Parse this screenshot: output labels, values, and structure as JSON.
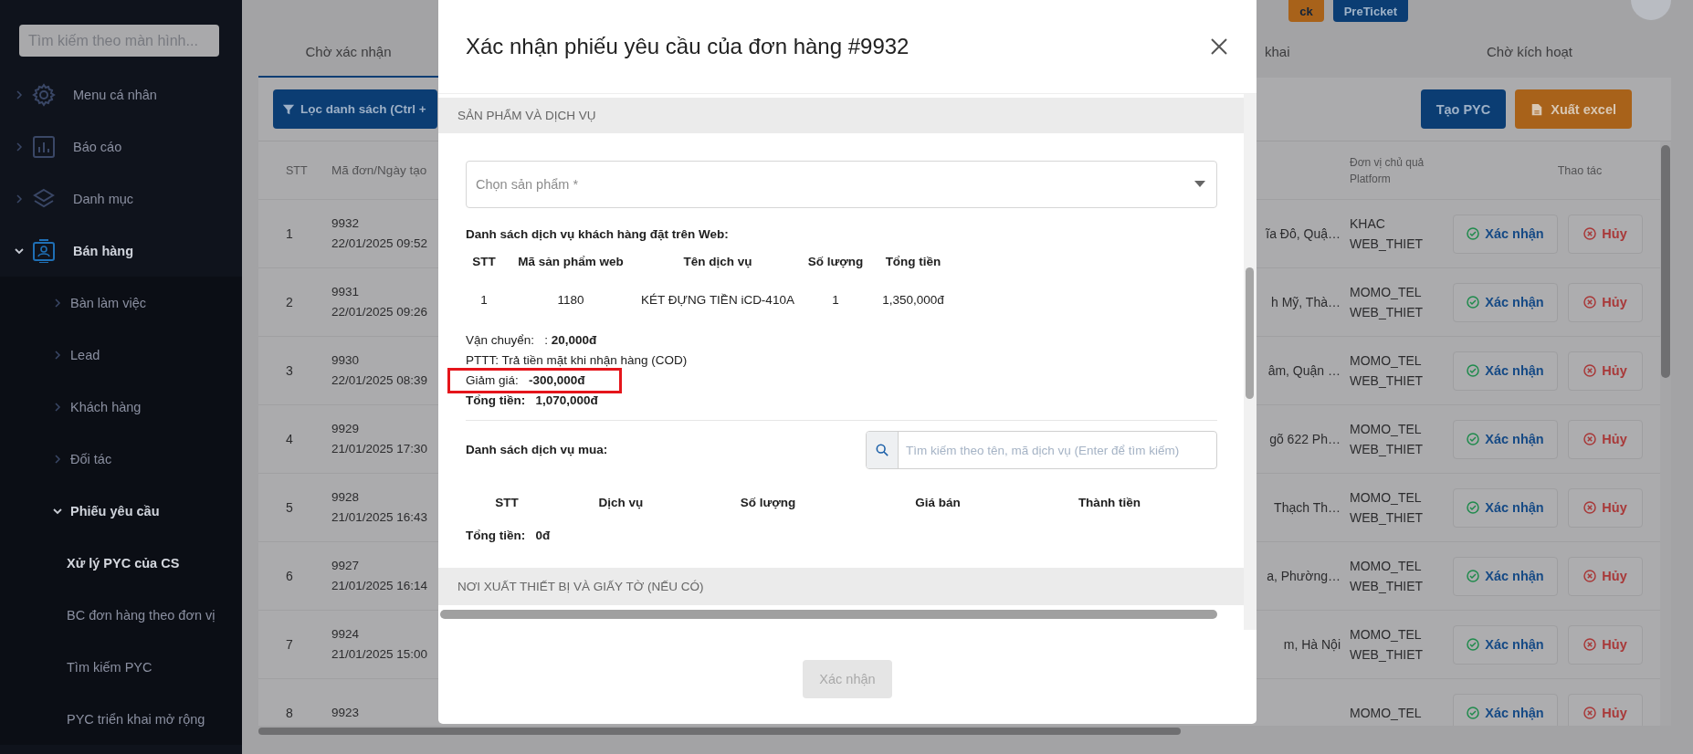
{
  "header": {
    "buttons": [
      {
        "label": "ck",
        "kind": "orange"
      },
      {
        "label": "PreTicket",
        "kind": "blue"
      }
    ]
  },
  "sidebar": {
    "search": {
      "placeholder": "Tìm kiếm theo màn hình..."
    },
    "items": [
      {
        "label": "Menu cá nhân",
        "expanded": false
      },
      {
        "label": "Báo cáo",
        "expanded": false
      },
      {
        "label": "Danh mục",
        "expanded": false
      },
      {
        "label": "Bán hàng",
        "expanded": true,
        "children": [
          {
            "label": "Bàn làm việc",
            "expanded": false
          },
          {
            "label": "Lead",
            "expanded": false
          },
          {
            "label": "Khách hàng",
            "expanded": false
          },
          {
            "label": "Đối tác",
            "expanded": false
          },
          {
            "label": "Phiếu yêu cầu",
            "expanded": true,
            "children": [
              {
                "label": "Xử lý PYC của CS",
                "selected": true
              },
              {
                "label": "BC đơn hàng theo đơn vị",
                "selected": false
              },
              {
                "label": "Tìm kiếm PYC",
                "selected": false
              },
              {
                "label": "PYC triển khai mở rộng",
                "selected": false
              }
            ]
          }
        ]
      }
    ]
  },
  "tabs": [
    {
      "label": "Chờ xác nhận",
      "selected": true
    },
    {
      "label": "khai",
      "selected": false
    },
    {
      "label": "Chờ kích hoạt",
      "selected": false
    }
  ],
  "toolbar": {
    "filter_button": "Lọc danh sách (Ctrl +",
    "buttons": [
      {
        "label": "Tạo PYC",
        "kind": "blue"
      },
      {
        "label": "Xuất excel",
        "kind": "orange"
      }
    ]
  },
  "table": {
    "columns": {
      "stt": "STT",
      "order": "Mã đơn/Ngày tạo",
      "unit": [
        "Đơn vị chủ quả",
        "Platform"
      ],
      "actions": "Thao tác"
    },
    "rows": [
      {
        "stt": "1",
        "order": [
          "9932",
          "22/01/2025 09:52"
        ],
        "address": "ĩa Đô, Quậ…",
        "unit": [
          "KHAC",
          "WEB_THIET"
        ],
        "confirm": "Xác nhận",
        "cancel": "Hủy"
      },
      {
        "stt": "2",
        "order": [
          "9931",
          "22/01/2025 09:26"
        ],
        "address": "h Mỹ, Thà…",
        "unit": [
          "MOMO_TEL",
          "WEB_THIET"
        ],
        "confirm": "Xác nhận",
        "cancel": "Hủy"
      },
      {
        "stt": "3",
        "order": [
          "9930",
          "22/01/2025 08:39"
        ],
        "address": "âm, Quận …",
        "unit": [
          "MOMO_TEL",
          "WEB_THIET"
        ],
        "confirm": "Xác nhận",
        "cancel": "Hủy"
      },
      {
        "stt": "4",
        "order": [
          "9929",
          "21/01/2025 17:30"
        ],
        "address": "gõ 622 Ph…",
        "unit": [
          "MOMO_TEL",
          "WEB_THIET"
        ],
        "confirm": "Xác nhận",
        "cancel": "Hủy"
      },
      {
        "stt": "5",
        "order": [
          "9928",
          "21/01/2025 16:43"
        ],
        "address": "Thạch Th…",
        "unit": [
          "MOMO_TEL",
          "WEB_THIET"
        ],
        "confirm": "Xác nhận",
        "cancel": "Hủy"
      },
      {
        "stt": "6",
        "order": [
          "9927",
          "21/01/2025 16:14"
        ],
        "address": "a, Phường…",
        "unit": [
          "MOMO_TEL",
          "WEB_THIET"
        ],
        "confirm": "Xác nhận",
        "cancel": "Hủy"
      },
      {
        "stt": "7",
        "order": [
          "9924",
          "21/01/2025 15:00"
        ],
        "address": "m, Hà Nội",
        "unit": [
          "MOMO_TEL",
          "WEB_THIET"
        ],
        "confirm": "Xác nhận",
        "cancel": "Hủy"
      },
      {
        "stt": "8",
        "order": [
          "9923"
        ],
        "unit": [
          "MOMO_TEL"
        ],
        "confirm": "Xác nhận",
        "cancel": "Hủy"
      }
    ]
  },
  "modal": {
    "title": "Xác nhận phiếu yêu cầu của đơn hàng #9932",
    "section_1": "SẢN PHẨM VÀ DỊCH VỤ",
    "product_select": {
      "placeholder": "Chọn sản phẩm *"
    },
    "web_orders": {
      "title": "Danh sách dịch vụ khách hàng đặt trên Web:",
      "columns": [
        "STT",
        "Mã sản phẩm web",
        "Tên dịch vụ",
        "Số lượng",
        "Tổng tiền"
      ],
      "rows": [
        [
          "1",
          "1180",
          "KÉT ĐỰNG TIỀN iCD-410A",
          "1",
          "1,350,000đ"
        ]
      ]
    },
    "summary": [
      {
        "kind": "line",
        "text": "Vận chuyển:   : **20,000đ**",
        "highlighted": false
      },
      {
        "kind": "line",
        "text": "PTTT: Trả tiền mặt khi nhận hàng (COD)",
        "highlighted": false
      },
      {
        "kind": "line",
        "text": "Giảm giá:   **-300,000đ**",
        "highlighted": true
      },
      {
        "kind": "total",
        "text": "Tổng tiền:   1,070,000đ",
        "highlighted": false
      }
    ],
    "purchased": {
      "title": "Danh sách dịch vụ mua:",
      "search": {
        "placeholder": "Tìm kiếm theo tên, mã dịch vụ (Enter để tìm kiếm)"
      },
      "columns": [
        "STT",
        "Dịch vụ",
        "Số lượng",
        "Giá bán",
        "Thành tiền"
      ],
      "total": "Tổng tiền:   0đ"
    },
    "section_2": "NƠI XUẤT THIẾT BỊ VÀ GIẤY TỜ (NẾU CÓ)",
    "submit": {
      "label": "Xác nhận",
      "disabled": true
    }
  }
}
